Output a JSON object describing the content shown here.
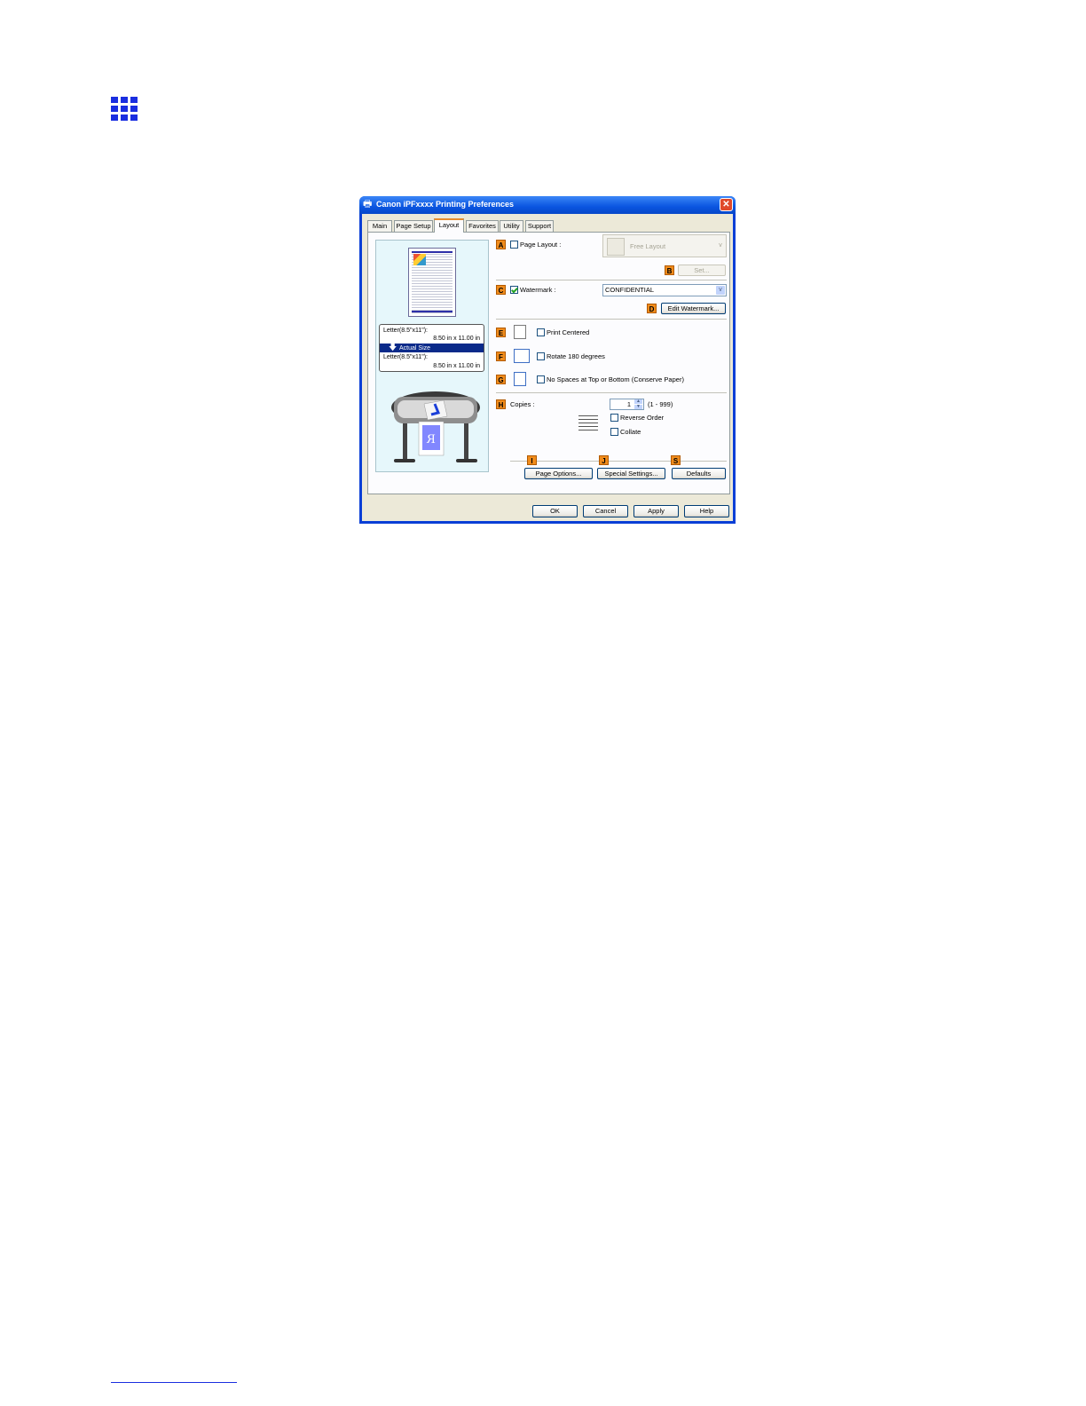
{
  "window": {
    "title": "Canon iPFxxxx Printing Preferences",
    "close_glyph": "✕"
  },
  "tabs": [
    {
      "label": "Main"
    },
    {
      "label": "Page Setup"
    },
    {
      "label": "Layout"
    },
    {
      "label": "Favorites"
    },
    {
      "label": "Utility"
    },
    {
      "label": "Support"
    }
  ],
  "active_tab": "Layout",
  "preview": {
    "original_label": "Letter(8.5\"x11\"):",
    "original_size": "8.50 in x 11.00 in",
    "scale_label": "Actual Size",
    "scale_arrow": "🡇",
    "output_label": "Letter(8.5\"x11\"):",
    "output_size": "8.50 in x 11.00 in"
  },
  "badges": {
    "a": "A",
    "b": "B",
    "c": "C",
    "d": "D",
    "e": "E",
    "f": "F",
    "g": "G",
    "h": "H",
    "i": "I",
    "j": "J",
    "s": "S"
  },
  "layout": {
    "page_layout_label": "Page Layout :",
    "page_layout_checked": false,
    "page_layout_value": "Free Layout",
    "set_label": "Set...",
    "watermark_label": "Watermark :",
    "watermark_checked": true,
    "watermark_value": "CONFIDENTIAL",
    "edit_watermark_label": "Edit Watermark...",
    "print_centered_label": "Print Centered",
    "rotate_label": "Rotate 180 degrees",
    "no_spaces_label": "No Spaces at Top or Bottom (Conserve Paper)",
    "copies_label": "Copies :",
    "copies_value": "1",
    "copies_range": "(1 - 999)",
    "reverse_order_label": "Reverse Order",
    "collate_label": "Collate",
    "page_options_label": "Page Options...",
    "special_settings_label": "Special Settings...",
    "defaults_label": "Defaults"
  },
  "footer": {
    "ok": "OK",
    "cancel": "Cancel",
    "apply": "Apply",
    "help": "Help"
  },
  "colors": {
    "title_bar": "#0a55e0",
    "badge": "#f08c1c",
    "page_icon": "#1a2ee0"
  }
}
